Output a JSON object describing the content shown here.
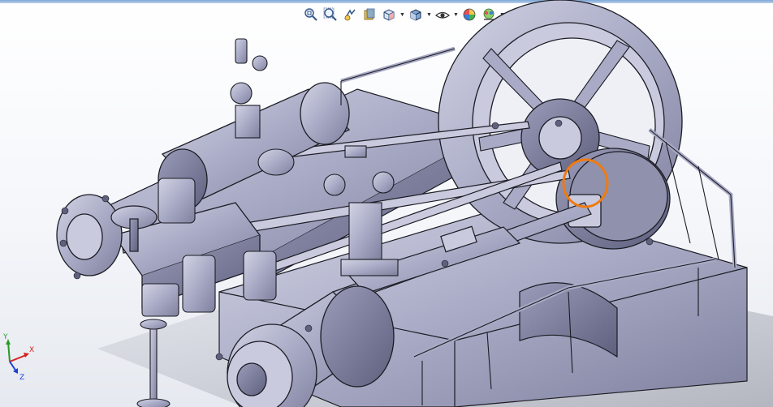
{
  "toolbar": {
    "buttons": [
      {
        "name": "zoom-to-fit",
        "icon": "zoom-fit-icon",
        "has_menu": false
      },
      {
        "name": "zoom-to-area",
        "icon": "zoom-area-icon",
        "has_menu": false
      },
      {
        "name": "previous-view",
        "icon": "previous-view-icon",
        "has_menu": false
      },
      {
        "name": "section-view",
        "icon": "section-view-icon",
        "has_menu": false
      },
      {
        "name": "view-orientation",
        "icon": "view-orientation-icon",
        "has_menu": true
      },
      {
        "name": "display-style",
        "icon": "display-style-icon",
        "has_menu": true
      },
      {
        "name": "hide-show-items",
        "icon": "hide-show-icon",
        "has_menu": true
      },
      {
        "name": "edit-appearance",
        "icon": "appearance-icon",
        "has_menu": false
      },
      {
        "name": "apply-scene",
        "icon": "scene-icon",
        "has_menu": true
      },
      {
        "name": "view-settings",
        "icon": "view-settings-icon",
        "has_menu": true
      }
    ]
  },
  "triad": {
    "x_label": "X",
    "y_label": "Y",
    "z_label": "Z",
    "x_color": "#d81f1f",
    "y_color": "#2a9a2a",
    "z_color": "#1f3fd8"
  },
  "model": {
    "body_color": "#a9abc6",
    "edge_color": "#1c1c24",
    "highlight_color": "#f07a10"
  },
  "colors": {
    "toolbar_strip": "#7fa7d6",
    "background_top": "#ffffff",
    "background_bottom": "#e6e9ef"
  }
}
